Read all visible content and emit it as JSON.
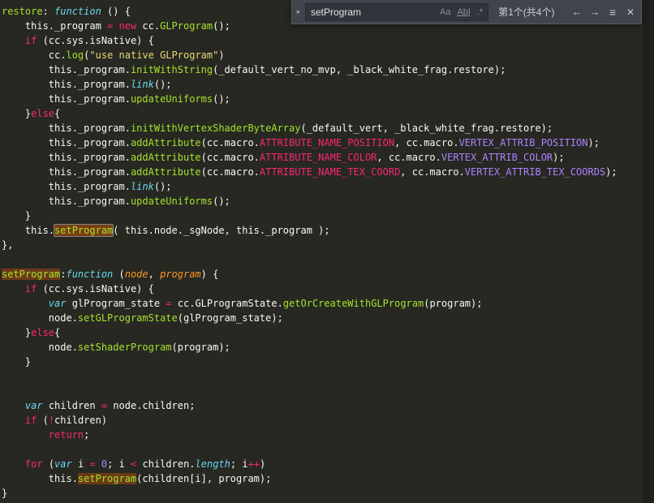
{
  "theme": {
    "background": "#272822",
    "foreground": "#f8f8f2",
    "keyword": "#f92672",
    "function": "#a6e22e",
    "string": "#e6db74",
    "constant": "#ae81ff",
    "builtin": "#66d9ef",
    "parameter": "#fd971f",
    "find_match_bg": "rgba(234,92,0,0.35)"
  },
  "find_widget": {
    "query": "setProgram",
    "match_count": "第1个(共4个)",
    "toggle_replace_icon": "▸",
    "match_case_label": "Aa",
    "whole_word_label": "Ab|",
    "regex_label": ".*",
    "prev_label": "←",
    "next_label": "→",
    "selection_icon": "≡",
    "close_label": "✕"
  },
  "code": {
    "language": "javascript",
    "lines": [
      [
        [
          "f",
          "restore"
        ],
        [
          "d",
          ": "
        ],
        [
          "t",
          "function"
        ],
        [
          "d",
          " () {"
        ]
      ],
      [
        [
          "d",
          "    this._program "
        ],
        [
          "k",
          "="
        ],
        [
          "d",
          " "
        ],
        [
          "k",
          "new"
        ],
        [
          "d",
          " cc."
        ],
        [
          "f",
          "GLProgram"
        ],
        [
          "d",
          "();"
        ]
      ],
      [
        [
          "d",
          "    "
        ],
        [
          "k",
          "if"
        ],
        [
          "d",
          " (cc.sys.isNative) {"
        ]
      ],
      [
        [
          "d",
          "        cc."
        ],
        [
          "f",
          "log"
        ],
        [
          "d",
          "("
        ],
        [
          "s",
          "\"use native GLProgram\""
        ],
        [
          "d",
          ")"
        ]
      ],
      [
        [
          "d",
          "        this._program."
        ],
        [
          "f",
          "initWithString"
        ],
        [
          "d",
          "(_default_vert_no_mvp, _black_white_frag.restore);"
        ]
      ],
      [
        [
          "d",
          "        this._program."
        ],
        [
          "t",
          "link"
        ],
        [
          "d",
          "();"
        ]
      ],
      [
        [
          "d",
          "        this._program."
        ],
        [
          "f",
          "updateUniforms"
        ],
        [
          "d",
          "();"
        ]
      ],
      [
        [
          "d",
          "    }"
        ],
        [
          "k",
          "else"
        ],
        [
          "d",
          "{"
        ]
      ],
      [
        [
          "d",
          "        this._program."
        ],
        [
          "f",
          "initWithVertexShaderByteArray"
        ],
        [
          "d",
          "(_default_vert, _black_white_frag.restore);"
        ]
      ],
      [
        [
          "d",
          "        this._program."
        ],
        [
          "f",
          "addAttribute"
        ],
        [
          "d",
          "(cc.macro."
        ],
        [
          "k",
          "ATTRIBUTE_NAME_POSITION"
        ],
        [
          "d",
          ", cc.macro."
        ],
        [
          "c",
          "VERTEX_ATTRIB_POSITION"
        ],
        [
          "d",
          ");"
        ]
      ],
      [
        [
          "d",
          "        this._program."
        ],
        [
          "f",
          "addAttribute"
        ],
        [
          "d",
          "(cc.macro."
        ],
        [
          "k",
          "ATTRIBUTE_NAME_COLOR"
        ],
        [
          "d",
          ", cc.macro."
        ],
        [
          "c",
          "VERTEX_ATTRIB_COLOR"
        ],
        [
          "d",
          ");"
        ]
      ],
      [
        [
          "d",
          "        this._program."
        ],
        [
          "f",
          "addAttribute"
        ],
        [
          "d",
          "(cc.macro."
        ],
        [
          "k",
          "ATTRIBUTE_NAME_TEX_COORD"
        ],
        [
          "d",
          ", cc.macro."
        ],
        [
          "c",
          "VERTEX_ATTRIB_TEX_COORDS"
        ],
        [
          "d",
          ");"
        ]
      ],
      [
        [
          "d",
          "        this._program."
        ],
        [
          "t",
          "link"
        ],
        [
          "d",
          "();"
        ]
      ],
      [
        [
          "d",
          "        this._program."
        ],
        [
          "f",
          "updateUniforms"
        ],
        [
          "d",
          "();"
        ]
      ],
      [
        [
          "d",
          "    }"
        ]
      ],
      [
        [
          "d",
          "    this."
        ],
        [
          "f",
          "setProgram",
          "current"
        ],
        [
          "d",
          "( this.node._sgNode, this._program );"
        ]
      ],
      [
        [
          "d",
          "},"
        ]
      ],
      [],
      [
        [
          "f",
          "setProgram",
          "match"
        ],
        [
          "d",
          ":"
        ],
        [
          "t",
          "function"
        ],
        [
          "d",
          " ("
        ],
        [
          "p",
          "node"
        ],
        [
          "d",
          ", "
        ],
        [
          "p",
          "program"
        ],
        [
          "d",
          ") {"
        ]
      ],
      [
        [
          "d",
          "    "
        ],
        [
          "k",
          "if"
        ],
        [
          "d",
          " (cc.sys.isNative) {"
        ]
      ],
      [
        [
          "d",
          "        "
        ],
        [
          "t",
          "var"
        ],
        [
          "d",
          " glProgram_state "
        ],
        [
          "k",
          "="
        ],
        [
          "d",
          " cc.GLProgramState."
        ],
        [
          "f",
          "getOrCreateWithGLProgram"
        ],
        [
          "d",
          "(program);"
        ]
      ],
      [
        [
          "d",
          "        node."
        ],
        [
          "f",
          "setGLProgramState"
        ],
        [
          "d",
          "(glProgram_state);"
        ]
      ],
      [
        [
          "d",
          "    }"
        ],
        [
          "k",
          "else"
        ],
        [
          "d",
          "{"
        ]
      ],
      [
        [
          "d",
          "        node."
        ],
        [
          "f",
          "setShaderProgram"
        ],
        [
          "d",
          "(program);"
        ]
      ],
      [
        [
          "d",
          "    }"
        ]
      ],
      [],
      [],
      [
        [
          "d",
          "    "
        ],
        [
          "t",
          "var"
        ],
        [
          "d",
          " children "
        ],
        [
          "k",
          "="
        ],
        [
          "d",
          " node.children;"
        ]
      ],
      [
        [
          "d",
          "    "
        ],
        [
          "k",
          "if"
        ],
        [
          "d",
          " ("
        ],
        [
          "k",
          "!"
        ],
        [
          "d",
          "children)"
        ]
      ],
      [
        [
          "d",
          "        "
        ],
        [
          "k",
          "return"
        ],
        [
          "d",
          ";"
        ]
      ],
      [],
      [
        [
          "d",
          "    "
        ],
        [
          "k",
          "for"
        ],
        [
          "d",
          " ("
        ],
        [
          "t",
          "var"
        ],
        [
          "d",
          " i "
        ],
        [
          "k",
          "="
        ],
        [
          "d",
          " "
        ],
        [
          "c",
          "0"
        ],
        [
          "d",
          "; i "
        ],
        [
          "k",
          "<"
        ],
        [
          "d",
          " children."
        ],
        [
          "t",
          "length"
        ],
        [
          "d",
          "; i"
        ],
        [
          "k",
          "++"
        ],
        [
          "d",
          ")"
        ]
      ],
      [
        [
          "d",
          "        this."
        ],
        [
          "f",
          "setProgram",
          "match"
        ],
        [
          "d",
          "(children[i], program);"
        ]
      ],
      [
        [
          "d",
          "}"
        ]
      ]
    ]
  }
}
